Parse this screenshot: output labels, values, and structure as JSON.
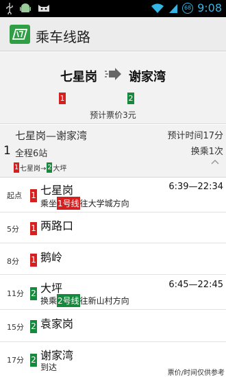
{
  "statusbar": {
    "time": "9:08",
    "badge": "68",
    "icons_left": [
      "usb-icon",
      "android-icon",
      "cat-icon"
    ],
    "icons_right": [
      "wifi-icon",
      "signal-icon",
      "battery-badge-icon"
    ]
  },
  "appbar": {
    "title": "乘车线路",
    "logo": "app-logo-icon"
  },
  "summary": {
    "from": "七星岗",
    "to": "谢家湾",
    "from_line": "1",
    "to_line": "2",
    "price": "预计票价3元"
  },
  "route": {
    "index": "1",
    "title": "七星岗—谢家湾",
    "time": "预计时间17分",
    "stops_count": "全程6站",
    "transfer": "换乘1次",
    "line_a": "1",
    "line_a_name": "七星岗→",
    "line_b": "2",
    "line_b_name": "大坪"
  },
  "stops": [
    {
      "label": "起点",
      "line": "1",
      "color": "#d61f1f",
      "name": "七星岗",
      "hours": "6:39—22:34",
      "sub_pre": "乘坐",
      "sub_chip": "1号线",
      "sub_post": "往大学城方向"
    },
    {
      "label": "5分",
      "line": "1",
      "color": "#d61f1f",
      "name": "两路口"
    },
    {
      "label": "8分",
      "line": "1",
      "color": "#d61f1f",
      "name": "鹅岭"
    },
    {
      "label": "11分",
      "line": "2",
      "color": "#168a3c",
      "name": "大坪",
      "hours": "6:45—22:45",
      "sub_pre": "换乘",
      "sub_chip": "2号线",
      "sub_post": "往新山村方向"
    },
    {
      "label": "15分",
      "line": "2",
      "color": "#168a3c",
      "name": "袁家岗"
    },
    {
      "label": "17分",
      "line": "2",
      "color": "#168a3c",
      "name": "谢家湾",
      "sub_pre": "到达"
    }
  ],
  "footer_note": "票价/时间仅供参考"
}
